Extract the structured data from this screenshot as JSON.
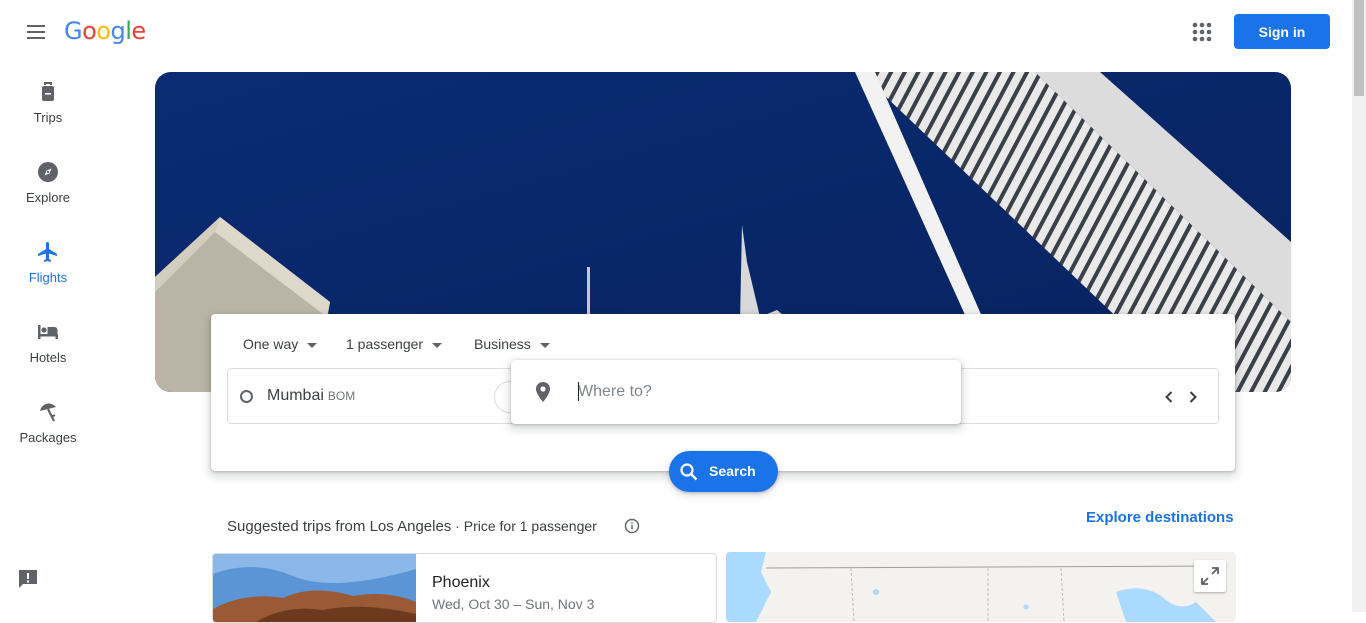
{
  "header": {
    "logo": {
      "text": "Google",
      "letters": [
        "G",
        "o",
        "o",
        "g",
        "l",
        "e"
      ],
      "colors": [
        "#4285f4",
        "#ea4335",
        "#fbbc05",
        "#4285f4",
        "#34a853",
        "#ea4335"
      ]
    },
    "menu_icon": "hamburger-icon",
    "apps_icon": "apps-grid-icon",
    "sign_in_label": "Sign in"
  },
  "sidebar": {
    "items": [
      {
        "label": "Trips",
        "icon": "luggage-icon",
        "active": false
      },
      {
        "label": "Explore",
        "icon": "compass-icon",
        "active": false
      },
      {
        "label": "Flights",
        "icon": "airplane-icon",
        "active": true
      },
      {
        "label": "Hotels",
        "icon": "bed-icon",
        "active": false
      },
      {
        "label": "Packages",
        "icon": "beach-umbrella-icon",
        "active": false
      }
    ],
    "feedback_icon": "feedback-icon"
  },
  "search": {
    "trip_type": "One way",
    "passengers": "1 passenger",
    "cabin_class": "Business",
    "origin_city": "Mumbai",
    "origin_code": "BOM",
    "destination_placeholder": "Where to?",
    "destination_value": "",
    "search_label": "Search"
  },
  "suggestions": {
    "heading": "Suggested trips from Los Angeles",
    "subheading": " · Price for 1 passenger",
    "explore_link": "Explore destinations",
    "trips": [
      {
        "city": "Phoenix",
        "dates": "Wed, Oct 30 – Sun, Nov 3"
      }
    ]
  },
  "colors": {
    "accent": "#1a73e8",
    "hero_sky": "#0a2a70"
  }
}
